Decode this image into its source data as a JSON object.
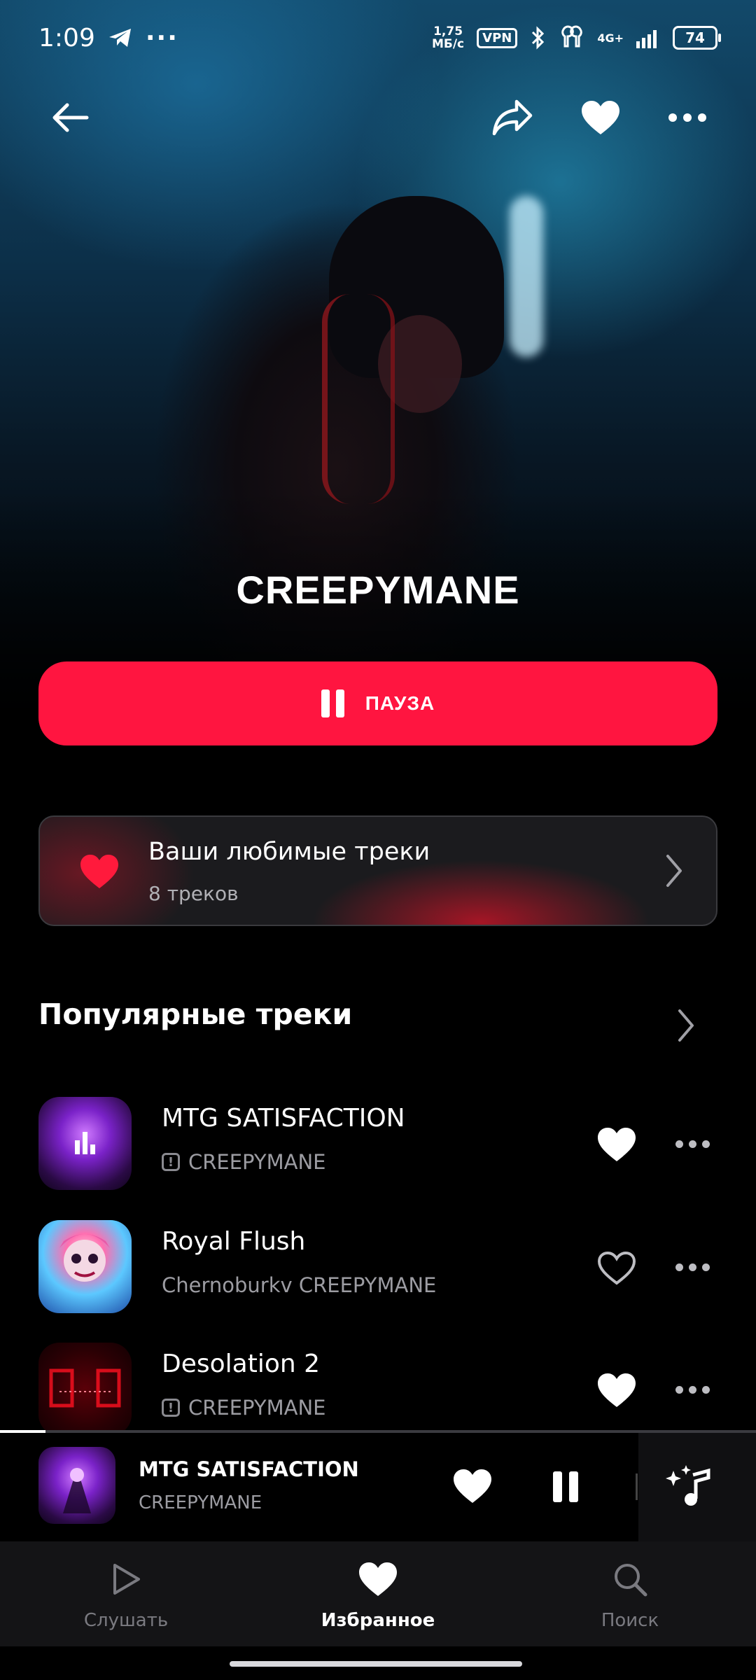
{
  "status_bar": {
    "time": "1:09",
    "net_speed_value": "1,75",
    "net_speed_unit": "МБ/с",
    "vpn": "VPN",
    "network": "4G+",
    "battery": "74"
  },
  "artist": {
    "name": "CREEPYMANE"
  },
  "play_button": {
    "label": "ПАУЗА"
  },
  "favorites_card": {
    "title": "Ваши любимые треки",
    "subtitle": "8 треков"
  },
  "popular": {
    "title": "Популярные треки",
    "tracks": [
      {
        "title": "MTG SATISFACTION",
        "artist": "CREEPYMANE",
        "explicit": true,
        "liked": true,
        "playing": true
      },
      {
        "title": "Royal Flush",
        "artist": "Chernoburkv CREEPYMANE",
        "explicit": false,
        "liked": false,
        "playing": false
      },
      {
        "title": "Desolation 2",
        "artist": "CREEPYMANE",
        "explicit": true,
        "liked": true,
        "playing": false
      }
    ]
  },
  "mini_player": {
    "title": "MTG SATISFACTION",
    "artist": "CREEPYMANE",
    "progress": 0.06
  },
  "bottom_nav": {
    "items": [
      {
        "label": "Слушать",
        "icon": "play-icon",
        "active": false
      },
      {
        "label": "Избранное",
        "icon": "heart-icon",
        "active": true
      },
      {
        "label": "Поиск",
        "icon": "search-icon",
        "active": false
      }
    ]
  },
  "colors": {
    "accent": "#ff1540",
    "background": "#000000"
  }
}
